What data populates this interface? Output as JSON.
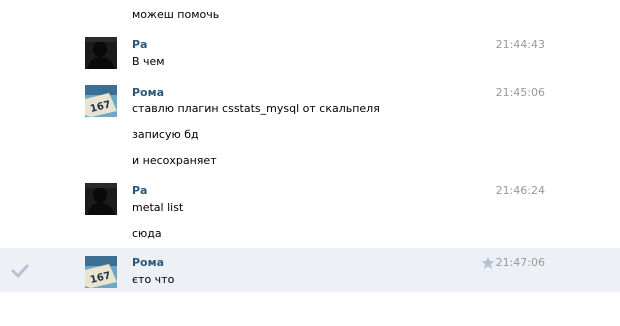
{
  "top_line": "можеш помочь",
  "messages": [
    {
      "author": "Ра",
      "time": "21:44:43",
      "lines": [
        "В чем"
      ],
      "avatar": "dark-silhouette-avatar"
    },
    {
      "author": "Рома",
      "time": "21:45:06",
      "lines": [
        "ставлю плагин csstats_mysql от скальпеля",
        "записую бд",
        "и несохраняет"
      ],
      "avatar": "number-sign-avatar"
    },
    {
      "author": "Ра",
      "time": "21:46:24",
      "lines": [
        "metal list",
        "сюда"
      ],
      "avatar": "dark-silhouette-avatar"
    },
    {
      "author": "Рома",
      "time": "21:47:06",
      "lines": [
        "єто что"
      ],
      "avatar": "number-sign-avatar",
      "selected": true
    }
  ],
  "avatar_plate_text": "167",
  "icons": {
    "check": "check-icon",
    "star": "star-icon"
  },
  "colors": {
    "author": "#2b587a",
    "time": "#999999",
    "selected_bg": "#edf1f5",
    "icon": "#b6c3d2"
  }
}
